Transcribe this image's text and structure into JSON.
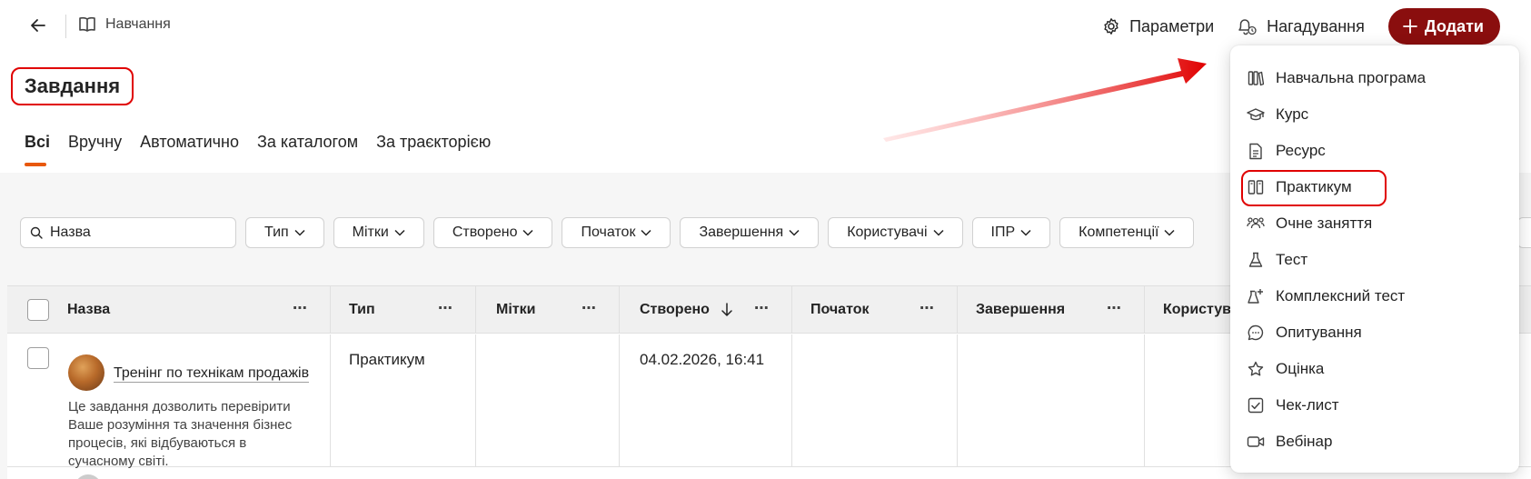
{
  "header": {
    "breadcrumb": "Навчання",
    "settings_label": "Параметри",
    "reminders_label": "Нагадування",
    "add_label": "Додати"
  },
  "page": {
    "title": "Завдання"
  },
  "tabs": [
    {
      "label": "Всі",
      "active": true
    },
    {
      "label": "Вручну"
    },
    {
      "label": "Автоматично"
    },
    {
      "label": "За каталогом"
    },
    {
      "label": "За траєкторією"
    }
  ],
  "filters": {
    "search_value": "Назва",
    "chips": [
      "Тип",
      "Мітки",
      "Створено",
      "Початок",
      "Завершення",
      "Користувачі",
      "ІПР",
      "Компетенції"
    ]
  },
  "table": {
    "columns": [
      "Назва",
      "Тип",
      "Мітки",
      "Створено",
      "Початок",
      "Завершення",
      "Користувач"
    ],
    "rows": [
      {
        "name": "Тренінг по технікам продажів",
        "description": "Це завдання дозволить перевірити Ваше розуміння та значення бізнес процесів, які відбуваються в сучасному світі.",
        "type": "Практикум",
        "labels": "",
        "created": "04.02.2026, 16:41",
        "start": "",
        "end": ""
      }
    ]
  },
  "add_menu": {
    "items": [
      {
        "label": "Навчальна програма",
        "icon": "books-icon"
      },
      {
        "label": "Курс",
        "icon": "graduation-cap-icon"
      },
      {
        "label": "Ресурс",
        "icon": "document-icon"
      },
      {
        "label": "Практикум",
        "icon": "practicum-books-icon",
        "highlighted": true
      },
      {
        "label": "Очне заняття",
        "icon": "people-icon"
      },
      {
        "label": "Тест",
        "icon": "flask-icon"
      },
      {
        "label": "Комплексний тест",
        "icon": "flask-plus-icon"
      },
      {
        "label": "Опитування",
        "icon": "chat-bubble-icon"
      },
      {
        "label": "Оцінка",
        "icon": "star-icon"
      },
      {
        "label": "Чек-лист",
        "icon": "checkbox-icon"
      },
      {
        "label": "Вебінар",
        "icon": "video-camera-icon"
      }
    ]
  },
  "colors": {
    "primary": "#8a0e0e",
    "tab_indicator": "#e8580b",
    "annotation": "#e00000"
  }
}
